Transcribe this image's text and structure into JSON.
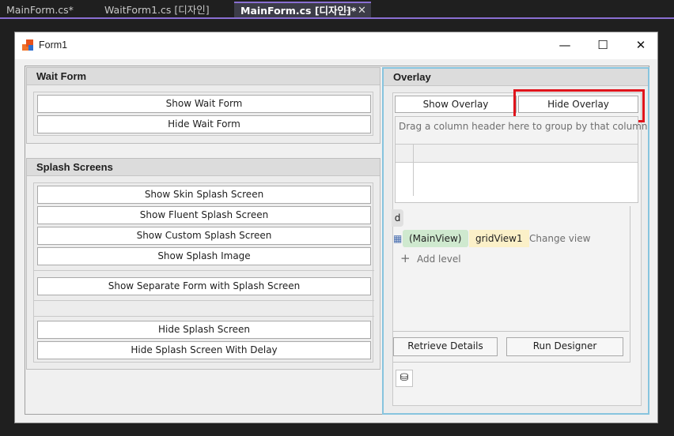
{
  "ide": {
    "tabs": [
      "MainForm.cs*",
      "WaitForm1.cs [디자인]",
      "MainForm.cs [디자인]*"
    ],
    "pin_icon": "pin-icon",
    "close_icon": "close-icon"
  },
  "form": {
    "title": "Form1",
    "minimize": "—",
    "maximize": "☐",
    "close": "✕"
  },
  "wait_form": {
    "header": "Wait Form",
    "buttons": [
      "Show Wait Form",
      "Hide Wait Form"
    ]
  },
  "splash": {
    "header": "Splash Screens",
    "buttons": [
      "Show Skin Splash Screen",
      "Show Fluent Splash Screen",
      "Show Custom Splash Screen",
      "Show Splash Image"
    ],
    "separate_button": "Show Separate Form with Splash Screen",
    "hide_buttons": [
      "Hide Splash Screen",
      "Hide Splash Screen With Delay"
    ]
  },
  "overlay": {
    "header": "Overlay",
    "show_button": "Show Overlay",
    "hide_button": "Hide Overlay",
    "group_panel_text": "Drag a column header here to group by that column",
    "level_tab": "d",
    "main_view": "(MainView)",
    "grid_view": "gridView1",
    "change_view": "Change view",
    "add_level": "Add level",
    "retrieve_button": "Retrieve Details",
    "run_designer_button": "Run Designer"
  },
  "colors": {
    "highlight": "#e0141c",
    "main_view_chip": "#cfe9cf",
    "grid_view_chip": "#fbf0c8"
  }
}
